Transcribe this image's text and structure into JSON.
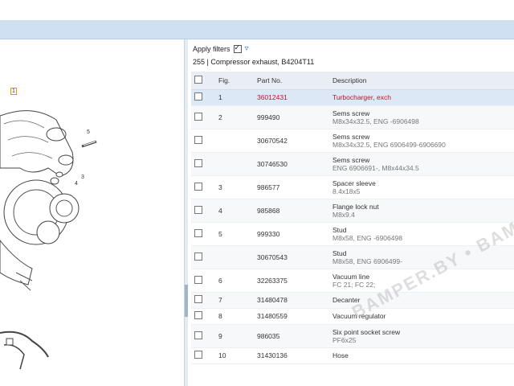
{
  "filters": {
    "label": "Apply filters",
    "checked": true,
    "icon": "filter-icon"
  },
  "group_title": "255  |  Compressor exhaust, B4204T11",
  "columns": [
    "Fig.",
    "Part No.",
    "Description"
  ],
  "rows": [
    {
      "fig": "1",
      "part": "36012431",
      "desc": "Turbocharger, exch",
      "sub": "",
      "selected": true
    },
    {
      "fig": "2",
      "part": "999490",
      "desc": "Sems screw",
      "sub": "M8x34x32.5, ENG -6906498"
    },
    {
      "fig": "",
      "part": "30670542",
      "desc": "Sems screw",
      "sub": "M8x34x32.5, ENG 6906499-6906690"
    },
    {
      "fig": "",
      "part": "30746530",
      "desc": "Sems screw",
      "sub": "ENG 6906691-, M8x44x34.5"
    },
    {
      "fig": "3",
      "part": "986577",
      "desc": "Spacer sleeve",
      "sub": "8.4x18x5"
    },
    {
      "fig": "4",
      "part": "985868",
      "desc": "Flange lock nut",
      "sub": "M8x9.4"
    },
    {
      "fig": "5",
      "part": "999330",
      "desc": "Stud",
      "sub": "M8x58, ENG -6906498"
    },
    {
      "fig": "",
      "part": "30670543",
      "desc": "Stud",
      "sub": "M8x58, ENG 6906499-"
    },
    {
      "fig": "6",
      "part": "32263375",
      "desc": "Vacuum line",
      "sub": "FC 21; FC 22;"
    },
    {
      "fig": "7",
      "part": "31480478",
      "desc": "Decanter",
      "sub": ""
    },
    {
      "fig": "8",
      "part": "31480559",
      "desc": "Vacuum regulator",
      "sub": ""
    },
    {
      "fig": "9",
      "part": "986035",
      "desc": "Six point socket screw",
      "sub": "PF6x25"
    },
    {
      "fig": "10",
      "part": "31430136",
      "desc": "Hose",
      "sub": ""
    }
  ],
  "diagram_callouts": [
    "1",
    "5",
    "3",
    "4"
  ],
  "watermark": "BAMPER.BY • BAMPER.BY • BAMPER.BY",
  "colors": {
    "accent_red": "#c8102e",
    "topbar": "#cfe0f3",
    "selected": "#dce8f5"
  }
}
